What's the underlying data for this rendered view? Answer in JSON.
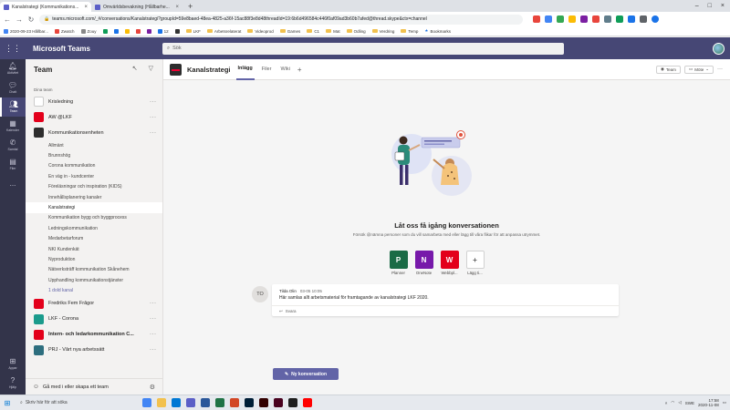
{
  "browser": {
    "tabs": [
      {
        "title": "Kanalstrategi (Kommunikations...",
        "active": true
      },
      {
        "title": "Omvärldsbevakning (Hållbarhe...",
        "active": false
      }
    ],
    "url": "teams.microsoft.com/_#/conversations/Kanalstrategi?groupId=59e8baed-48ea-4825-a36f-15ac88f3e8d48threadId=19:6b6d496584c446f0af09ad3b60b7afed@thread.skype&ctx=channel",
    "bookmarks": [
      "2020-09-23 Hållbar...",
      "Zwatch",
      "Zouy",
      "",
      "",
      "",
      "",
      "",
      "12",
      "",
      "LKF",
      "Arbetsrelaterat",
      "Videoprod",
      "Games",
      "C1",
      "Mat",
      "Odling",
      "Verdring",
      "Temp",
      "Bookmarks"
    ]
  },
  "teams": {
    "app_name": "Microsoft Teams",
    "search_placeholder": "Sök"
  },
  "rail": [
    {
      "label": "Aktivitet",
      "icon": "bell-icon",
      "active": false
    },
    {
      "label": "Chatt",
      "icon": "chat-icon",
      "active": false
    },
    {
      "label": "Team",
      "icon": "teams-icon",
      "active": true
    },
    {
      "label": "Kalender",
      "icon": "calendar-icon",
      "active": false
    },
    {
      "label": "Samtal",
      "icon": "phone-icon",
      "active": false
    },
    {
      "label": "Filer",
      "icon": "files-icon",
      "active": false
    },
    {
      "label": "...",
      "icon": "more-icon",
      "active": false
    }
  ],
  "rail_bottom": [
    {
      "label": "Appar",
      "icon": "apps-icon"
    },
    {
      "label": "Hjälp",
      "icon": "help-icon"
    }
  ],
  "pane": {
    "title": "Team",
    "section": "Dina team",
    "teams_top": [
      {
        "name": "Krisledning",
        "color": "#ffffff",
        "bold": false
      },
      {
        "name": "AW @LKF",
        "color": "#e3001b",
        "bold": false
      },
      {
        "name": "Kommunikationsenheten",
        "color": "#2d2d2d",
        "bold": false
      }
    ],
    "channels": [
      {
        "name": "Allmänt",
        "state": "normal"
      },
      {
        "name": "Brunnshög",
        "state": "normal"
      },
      {
        "name": "Corona kommunikation",
        "state": "normal"
      },
      {
        "name": "En väg in - kundcenter",
        "state": "normal"
      },
      {
        "name": "Föreläsningar och inspiration (KIDS)",
        "state": "normal"
      },
      {
        "name": "Innehållsplanering kanaler",
        "state": "normal"
      },
      {
        "name": "Kanalstrategi",
        "state": "active"
      },
      {
        "name": "Kommunikation bygg och byggprocess",
        "state": "normal"
      },
      {
        "name": "Ledningskommunikation",
        "state": "normal"
      },
      {
        "name": "Medarbetarforum",
        "state": "normal"
      },
      {
        "name": "NKI Kundenkät",
        "state": "normal"
      },
      {
        "name": "Nyproduktion",
        "state": "normal"
      },
      {
        "name": "Nätverksträff kommunikation Skånehem",
        "state": "normal"
      },
      {
        "name": "Upphandling kommunikationstjänster",
        "state": "normal"
      },
      {
        "name": "1 dold kanal",
        "state": "link"
      }
    ],
    "teams_bottom": [
      {
        "name": "Fredriks Fem Frågor",
        "color": "#e3001b",
        "bold": false
      },
      {
        "name": "LKF - Corona",
        "color": "#1a9b8c",
        "bold": false
      },
      {
        "name": "Intern- och ledarkommunikation C...",
        "color": "#e3001b",
        "bold": true
      },
      {
        "name": "PRJ - Vårt nya arbetssätt",
        "color": "#2d6e7e",
        "bold": false
      }
    ],
    "join_label": "Gå med i eller skapa ett team"
  },
  "channel": {
    "name": "Kanalstrategi",
    "tabs": [
      "Inlägg",
      "Filer",
      "Wiki"
    ],
    "team_pill": "Team",
    "meet_pill": "Möte"
  },
  "empty_state": {
    "title": "Låt oss få igång konversationen",
    "subtitle": "Försök @nämna personer som du vill samarbeta med eller lägg till våra flikar för att anpassa utrymmet."
  },
  "apps": [
    {
      "label": "Planner",
      "color": "#1a6b46",
      "glyph": "P"
    },
    {
      "label": "OneNote",
      "color": "#7719aa",
      "glyph": "N"
    },
    {
      "label": "Webbpl...",
      "color": "#e3001b",
      "glyph": "W"
    },
    {
      "label": "Lägg ti...",
      "color": "#ffffff",
      "glyph": "+"
    }
  ],
  "message": {
    "initials": "TO",
    "author": "Tilda Olin",
    "time": "03-05 10:05",
    "text": "Här samlas allt arbetsmaterial för framtagande av kanalstrategi LKF 2020.",
    "reply": "Svara"
  },
  "new_conversation": "Ny konversation",
  "taskbar": {
    "search_placeholder": "Skriv här för att söka",
    "tray_lang": "SWE",
    "time": "17:58",
    "date": "2020-11-08"
  }
}
